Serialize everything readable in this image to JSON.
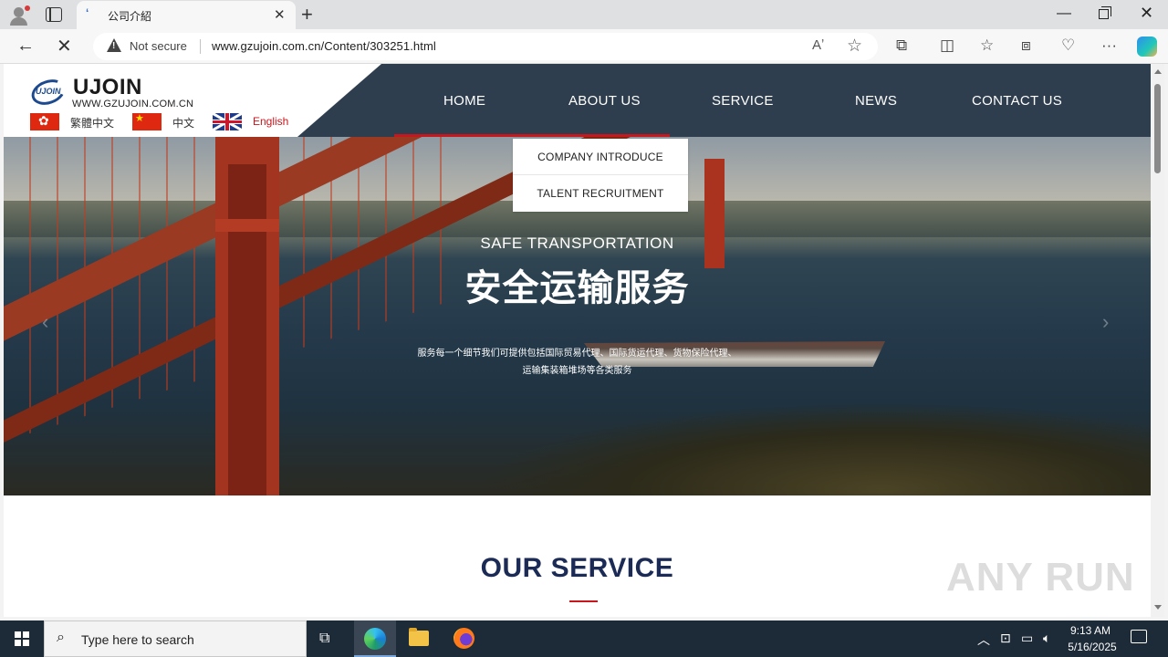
{
  "browser": {
    "tab_title": "公司介紹",
    "tab_close": "✕",
    "new_tab": "+",
    "security_label": "Not secure",
    "url": "www.gzujoin.com.cn/Content/303251.html"
  },
  "site": {
    "logo_name": "UJOIN",
    "logo_mark": "UJOIN",
    "logo_domain": "WWW.GZUJOIN.COM.CN",
    "languages": [
      {
        "label": "繁體中文",
        "flag": "hong-kong"
      },
      {
        "label": "中文",
        "flag": "china"
      },
      {
        "label": "English",
        "flag": "united-kingdom",
        "active": true
      }
    ],
    "nav": [
      "HOME",
      "ABOUT US",
      "SERVICE",
      "NEWS",
      "CONTACT US"
    ],
    "dropdown": [
      "COMPANY INTRODUCE",
      "TALENT RECRUITMENT"
    ],
    "hero": {
      "subtitle": "SAFE TRANSPORTATION",
      "title": "安全运输服务",
      "desc_line1": "服务每一个细节我们可提供包括国际贸易代理、国际货运代理、货物保险代理、",
      "desc_line2": "运输集装箱堆场等各类服务",
      "prev": "‹",
      "next": "›"
    },
    "section_title": "OUR SERVICE",
    "watermark": "ANY RUN"
  },
  "taskbar": {
    "search_placeholder": "Type here to search",
    "time": "9:13 AM",
    "date": "5/16/2025"
  },
  "colors": {
    "nav_bg": "#2f3e4e",
    "accent_red": "#c8161d",
    "section_title": "#1c2b55"
  }
}
